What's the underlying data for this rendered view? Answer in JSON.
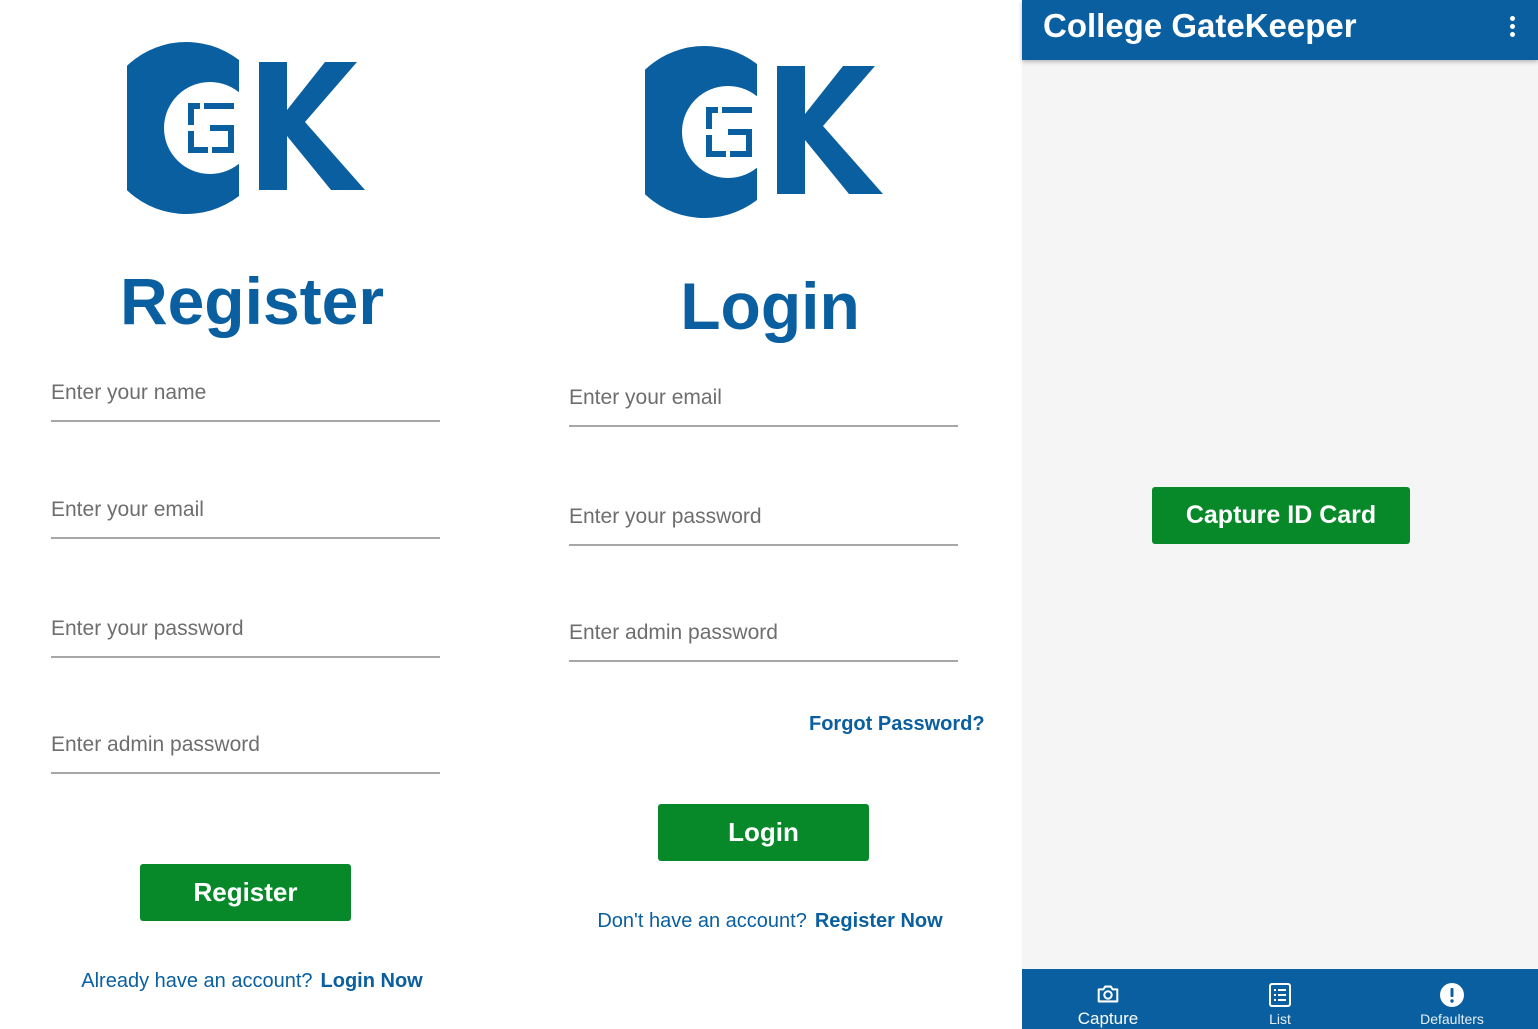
{
  "colors": {
    "brand_blue": "#0a5fa0",
    "button_green": "#07892a",
    "underline_gray": "#a7a7a7",
    "placeholder_gray": "#6e6e6e",
    "main_background": "#f5f5f5"
  },
  "register": {
    "logo_icon": "college-gatekeeper-logo",
    "heading": "Register",
    "fields": [
      {
        "placeholder": "Enter your name",
        "value": ""
      },
      {
        "placeholder": "Enter your email",
        "value": ""
      },
      {
        "placeholder": "Enter your password",
        "value": ""
      },
      {
        "placeholder": "Enter admin password",
        "value": ""
      }
    ],
    "button_label": "Register",
    "footer_text": "Already have an account?",
    "footer_link": "Login Now"
  },
  "login": {
    "logo_icon": "college-gatekeeper-logo",
    "heading": "Login",
    "fields": [
      {
        "placeholder": "Enter your email",
        "value": ""
      },
      {
        "placeholder": "Enter your password",
        "value": ""
      },
      {
        "placeholder": "Enter admin password",
        "value": ""
      }
    ],
    "forgot_label": "Forgot Password?",
    "button_label": "Login",
    "footer_text": "Don't have an account?",
    "footer_link": "Register Now"
  },
  "main": {
    "app_title": "College GateKeeper",
    "menu_icon": "more-vert-icon",
    "capture_button": "Capture ID Card",
    "nav": [
      {
        "label": "Capture",
        "icon": "camera-icon",
        "active": true
      },
      {
        "label": "List",
        "icon": "list-icon",
        "active": false
      },
      {
        "label": "Defaulters",
        "icon": "alert-icon",
        "active": false
      }
    ]
  }
}
